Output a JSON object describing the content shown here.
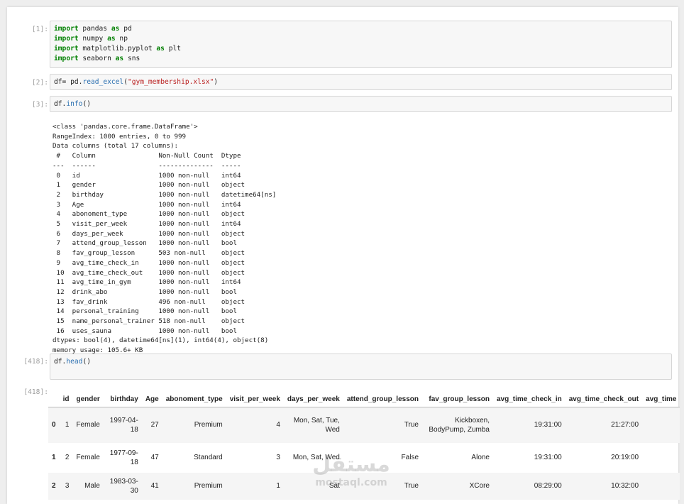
{
  "cells": [
    {
      "prompt": "[1]:",
      "lines": [
        [
          {
            "t": "import",
            "c": "kw"
          },
          {
            "t": " pandas "
          },
          {
            "t": "as",
            "c": "kw"
          },
          {
            "t": " pd"
          }
        ],
        [
          {
            "t": "import",
            "c": "kw"
          },
          {
            "t": " numpy "
          },
          {
            "t": "as",
            "c": "kw"
          },
          {
            "t": " np"
          }
        ],
        [
          {
            "t": "import",
            "c": "kw"
          },
          {
            "t": " matplotlib.pyplot "
          },
          {
            "t": "as",
            "c": "kw"
          },
          {
            "t": " plt"
          }
        ],
        [
          {
            "t": "import",
            "c": "kw"
          },
          {
            "t": " seaborn "
          },
          {
            "t": "as",
            "c": "kw"
          },
          {
            "t": " sns"
          }
        ]
      ]
    },
    {
      "prompt": "[2]:",
      "lines": [
        [
          {
            "t": "df= pd."
          },
          {
            "t": "read_excel",
            "c": "fn"
          },
          {
            "t": "("
          },
          {
            "t": "\"gym_membership.xlsx\"",
            "c": "st"
          },
          {
            "t": ")"
          }
        ]
      ]
    },
    {
      "prompt": "[3]:",
      "lines": [
        [
          {
            "t": "df."
          },
          {
            "t": "info",
            "c": "fn"
          },
          {
            "t": "()"
          }
        ]
      ]
    },
    {
      "prompt": "[418]:",
      "lines": [
        [
          {
            "t": "df."
          },
          {
            "t": "head",
            "c": "fn"
          },
          {
            "t": "()"
          }
        ]
      ]
    }
  ],
  "info_output": [
    "<class 'pandas.core.frame.DataFrame'>",
    "RangeIndex: 1000 entries, 0 to 999",
    "Data columns (total 17 columns):",
    " #   Column                Non-Null Count  Dtype",
    "---  ------                --------------  -----",
    " 0   id                    1000 non-null   int64",
    " 1   gender                1000 non-null   object",
    " 2   birthday              1000 non-null   datetime64[ns]",
    " 3   Age                   1000 non-null   int64",
    " 4   abonoment_type        1000 non-null   object",
    " 5   visit_per_week        1000 non-null   int64",
    " 6   days_per_week         1000 non-null   object",
    " 7   attend_group_lesson   1000 non-null   bool",
    " 8   fav_group_lesson      503 non-null    object",
    " 9   avg_time_check_in     1000 non-null   object",
    " 10  avg_time_check_out    1000 non-null   object",
    " 11  avg_time_in_gym       1000 non-null   int64",
    " 12  drink_abo             1000 non-null   bool",
    " 13  fav_drink             496 non-null    object",
    " 14  personal_training     1000 non-null   bool",
    " 15  name_personal_trainer 518 non-null    object",
    " 16  uses_sauna            1000 non-null   bool",
    "dtypes: bool(4), datetime64[ns](1), int64(4), object(8)",
    "memory usage: 105.6+ KB"
  ],
  "out_prompt": "[418]:",
  "table": {
    "columns": [
      "",
      "id",
      "gender",
      "birthday",
      "Age",
      "abonoment_type",
      "visit_per_week",
      "days_per_week",
      "attend_group_lesson",
      "fav_group_lesson",
      "avg_time_check_in",
      "avg_time_check_out",
      "avg_time"
    ],
    "rows": [
      [
        "0",
        "1",
        "Female",
        "1997-04-18",
        "27",
        "Premium",
        "4",
        "Mon, Sat, Tue, Wed",
        "True",
        "Kickboxen, BodyPump, Zumba",
        "19:31:00",
        "21:27:00",
        ""
      ],
      [
        "1",
        "2",
        "Female",
        "1977-09-18",
        "47",
        "Standard",
        "3",
        "Mon, Sat, Wed",
        "False",
        "Alone",
        "19:31:00",
        "20:19:00",
        ""
      ],
      [
        "2",
        "3",
        "Male",
        "1983-03-30",
        "41",
        "Premium",
        "1",
        "Sat",
        "True",
        "XCore",
        "08:29:00",
        "10:32:00",
        ""
      ]
    ]
  },
  "watermark": {
    "big": "مستقل",
    "small": "mostaql.com"
  }
}
